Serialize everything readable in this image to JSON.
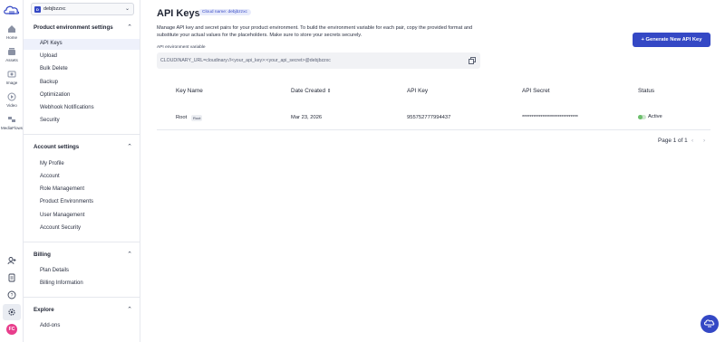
{
  "rail": {
    "items": [
      {
        "label": "Home",
        "icon": "home-icon"
      },
      {
        "label": "Assets",
        "icon": "assets-icon"
      },
      {
        "label": "Image",
        "icon": "image-icon"
      },
      {
        "label": "Video",
        "icon": "video-icon"
      },
      {
        "label": "MediaFlows",
        "icon": "mediaflows-icon"
      }
    ],
    "avatar": "FC"
  },
  "sidebar": {
    "env_name": "debjbzzxc",
    "sections": [
      {
        "title": "Product environment settings",
        "items": [
          "API Keys",
          "Upload",
          "Bulk Delete",
          "Backup",
          "Optimization",
          "Webhook Notifications",
          "Security"
        ]
      },
      {
        "title": "Account settings",
        "items": [
          "My Profile",
          "Account",
          "Role Management",
          "Product Environments",
          "User Management",
          "Account Security"
        ]
      },
      {
        "title": "Billing",
        "items": [
          "Plan Details",
          "Billing Information"
        ]
      },
      {
        "title": "Explore",
        "items": [
          "Add-ons"
        ]
      }
    ]
  },
  "main": {
    "title": "API Keys",
    "cloud_badge": "Cloud name: debjbzzxc",
    "description": "Manage API key and secret pairs for your product environment. To build the environment variable for each pair, copy the provided format and substitute your actual values for the placeholders. Make sure to store your secrets securely.",
    "generate_button": "+ Generate New API Key",
    "env_var_label": "API environment variable",
    "env_var_value": "CLOUDINARY_URL=cloudinary://<your_api_key>:<your_api_secret>@debjbzzxc",
    "table": {
      "headers": [
        "Key Name",
        "Date Created",
        "API Key",
        "API Secret",
        "Status"
      ],
      "rows": [
        {
          "key_name": "Root",
          "badge": "Root",
          "date": "Mar 23, 2026",
          "api_key": "955752777994437",
          "api_secret": "******************************",
          "status": "Active"
        }
      ]
    },
    "pager": "Page 1 of 1",
    "accent": "#3448c5"
  }
}
